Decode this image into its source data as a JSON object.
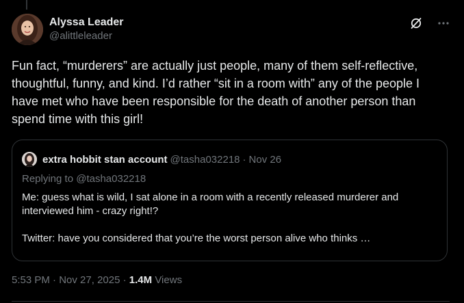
{
  "author": {
    "display_name": "Alyssa Leader",
    "handle": "@alittleleader"
  },
  "post": {
    "text": "Fun fact, “murderers” are actually just people, many of them self-reflective, thoughtful, funny, and kind. I’d rather “sit in a room with” any of the people I have met who have been responsible for the death of another person than spend time with this girl!",
    "time": "5:53 PM",
    "separator1": "·",
    "date": "Nov 27, 2025",
    "separator2": "·",
    "views_count": "1.4M",
    "views_label": "Views"
  },
  "quote": {
    "display_name": "extra hobbit stan account",
    "handle": "@tasha032218",
    "separator": "·",
    "date": "Nov 26",
    "replying_to": "Replying to @tasha032218",
    "line1": "Me: guess what is wild, I sat alone in a room with a recently released murderer and interviewed him - crazy right!?",
    "line2": "Twitter: have you considered that you’re the worst person alive who thinks …"
  },
  "icons": {
    "grok": "grok-icon",
    "more": "more-icon"
  },
  "colors": {
    "background": "#000000",
    "text_primary": "#e7e9ea",
    "text_secondary": "#71767b",
    "border": "#2f3336"
  }
}
